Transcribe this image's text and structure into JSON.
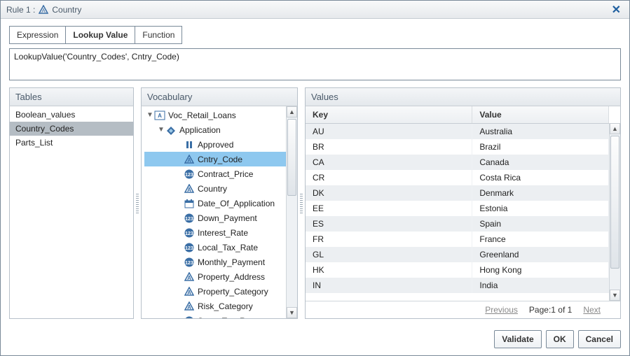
{
  "title": {
    "prefix": "Rule 1 :",
    "name": "Country"
  },
  "tabs": {
    "expression": "Expression",
    "lookup": "Lookup Value",
    "function": "Function",
    "active": "lookup"
  },
  "expression_text": "LookupValue('Country_Codes', Cntry_Code)",
  "panels": {
    "tables": "Tables",
    "vocab": "Vocabulary",
    "values": "Values"
  },
  "tables": {
    "items": [
      "Boolean_values",
      "Country_Codes",
      "Parts_List"
    ],
    "selected_index": 1
  },
  "vocab": {
    "root": "Voc_Retail_Loans",
    "app": "Application",
    "selected": "Cntry_Code",
    "nodes": [
      {
        "icon": "bool",
        "label": "Approved"
      },
      {
        "icon": "attr",
        "label": "Cntry_Code"
      },
      {
        "icon": "num",
        "label": "Contract_Price"
      },
      {
        "icon": "attr",
        "label": "Country"
      },
      {
        "icon": "date",
        "label": "Date_Of_Application"
      },
      {
        "icon": "num",
        "label": "Down_Payment"
      },
      {
        "icon": "num",
        "label": "Interest_Rate"
      },
      {
        "icon": "num",
        "label": "Local_Tax_Rate"
      },
      {
        "icon": "num",
        "label": "Monthly_Payment"
      },
      {
        "icon": "attr",
        "label": "Property_Address"
      },
      {
        "icon": "attr",
        "label": "Property_Category"
      },
      {
        "icon": "attr",
        "label": "Risk_Category"
      },
      {
        "icon": "num",
        "label": "State_Tax_Rate"
      }
    ]
  },
  "values": {
    "headers": {
      "key": "Key",
      "value": "Value"
    },
    "rows": [
      {
        "k": "AU",
        "v": "Australia"
      },
      {
        "k": "BR",
        "v": "Brazil"
      },
      {
        "k": "CA",
        "v": "Canada"
      },
      {
        "k": "CR",
        "v": "Costa Rica"
      },
      {
        "k": "DK",
        "v": "Denmark"
      },
      {
        "k": "EE",
        "v": "Estonia"
      },
      {
        "k": "ES",
        "v": "Spain"
      },
      {
        "k": "FR",
        "v": "France"
      },
      {
        "k": "GL",
        "v": "Greenland"
      },
      {
        "k": "HK",
        "v": "Hong Kong"
      },
      {
        "k": "IN",
        "v": "India"
      }
    ],
    "pager": {
      "prev": "Previous",
      "page": "Page:1 of 1",
      "next": "Next"
    }
  },
  "buttons": {
    "validate": "Validate",
    "ok": "OK",
    "cancel": "Cancel"
  }
}
